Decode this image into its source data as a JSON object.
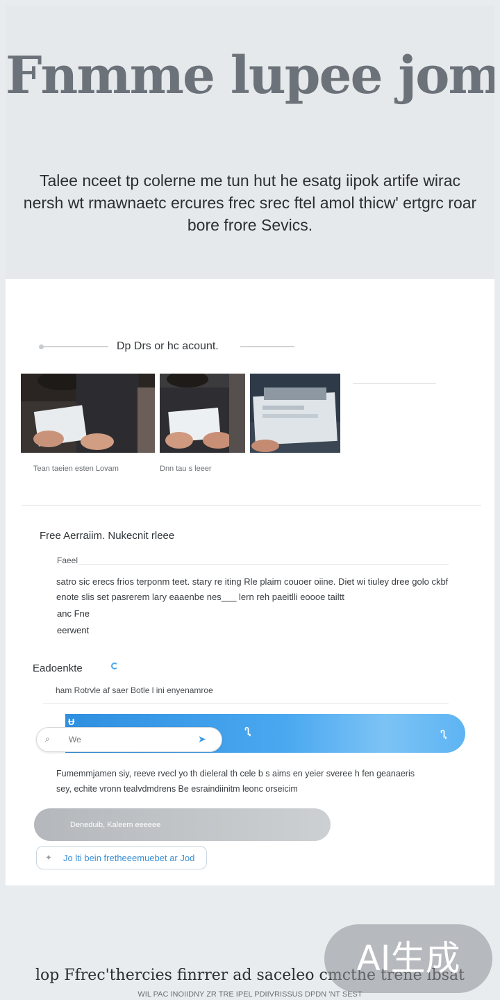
{
  "hero": {
    "title": "Fnmme lupee jomn'ad",
    "subtitle": "Talee nceet tp colerne me tun hut he esatg iipok artife wirac nersh wt rmawnaetc ercures frec srec ftel amol thicw' ertgrc roar bore frore Sevics."
  },
  "accounts": {
    "divider_label": "Dp Drs or hc acount.",
    "captions": [
      "Tean taeien esten Lovam",
      "Dnn tau s leeer"
    ]
  },
  "free_section": {
    "title": "Free Aerraiim. Nukecnit rleee",
    "field_label": "Faeel",
    "paragraph": "satro sic erecs frios terponm teet. stary re iting  Rle plaim couoer oiine. Diet wi tiuley dree golo ckbf enote slis set pasrerem lary eaaenbe nes___ lern reh paeitlli eoooe tailtt",
    "bold_line_1": "anc Fne",
    "bold_line_2": "eerwent"
  },
  "edit_section": {
    "title": "Eadoenkte",
    "description": "ham Rotrvle af saer Botle l ini enyenamroe"
  },
  "search": {
    "placeholder": "We",
    "icon": "search-icon",
    "go_icon": "arrow-icon"
  },
  "gradient_bar": {
    "marks": [
      "Ʉ",
      "Ⴂ",
      "Ⴂ"
    ]
  },
  "body_text": "Fumemmjamen siy, reeve rvecl yo th dieleral th cele b s aims en yeier sveree h fen geanaeris sey, echite vronn tealvdmdrens Be esraindiinitm leonc orseicim",
  "buttons": {
    "grey_label": "Deneduib,  Kaleem eeeeee",
    "outline_label": "Jo lti bein fretheeemuebet ar Jod"
  },
  "footer": {
    "title": "lop Ffrec'thercies finrrer ad saceleo cmcthe trene ibsat",
    "subtitle": "WIL PAC INOIIDNY ZR TRE IPEL PDIIVRISSUS DPDN 'NT SEST"
  },
  "watermark": "AI生成",
  "colors": {
    "accent": "#3a9be8",
    "gradient_start": "#2f8fe0",
    "gradient_end": "#7cc3f5"
  }
}
